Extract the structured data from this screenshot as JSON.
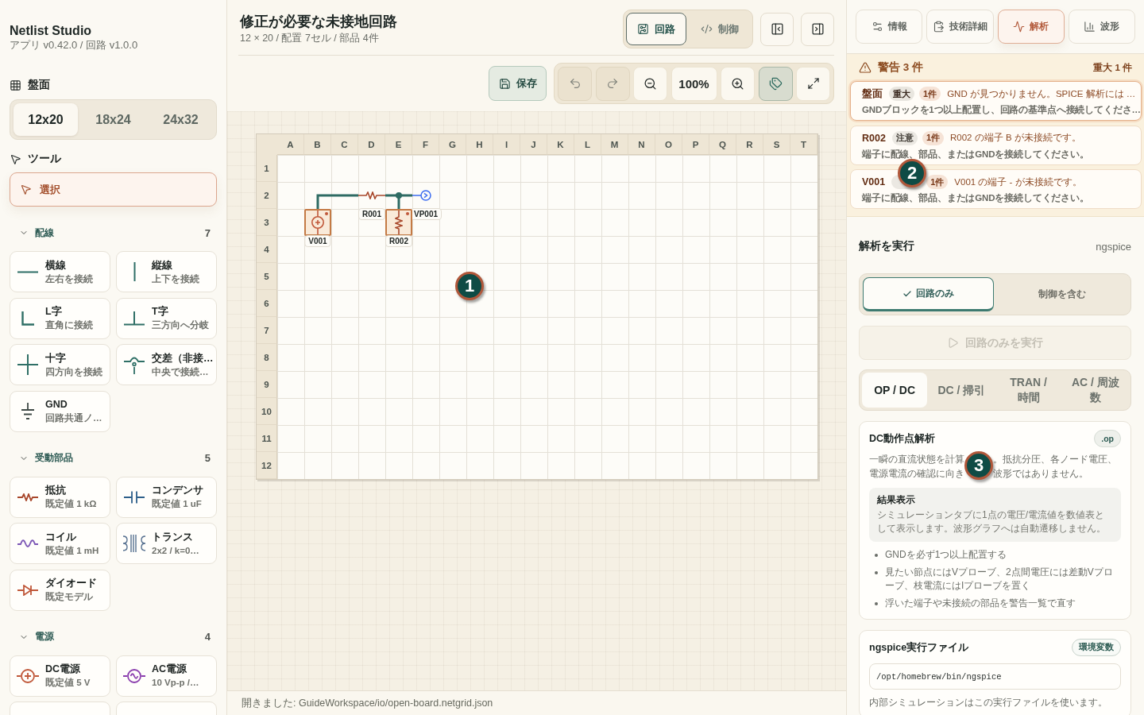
{
  "app": {
    "name": "Netlist Studio",
    "version": "アプリ v0.42.0 / 回路 v1.0.0"
  },
  "board_size": {
    "heading": "盤面",
    "options": [
      {
        "label": "12x20",
        "selected": true
      },
      {
        "label": "18x24",
        "selected": false
      },
      {
        "label": "24x32",
        "selected": false
      }
    ]
  },
  "tools": {
    "heading": "ツール",
    "items": [
      {
        "label": "選択",
        "selected": true
      }
    ]
  },
  "palette": [
    {
      "name": "配線",
      "count": "7",
      "expanded": true,
      "items": [
        {
          "kind": "wire-h",
          "title": "横線",
          "subtitle": "左右を接続"
        },
        {
          "kind": "wire-v",
          "title": "縦線",
          "subtitle": "上下を接続"
        },
        {
          "kind": "wire-l",
          "title": "L字",
          "subtitle": "直角に接続"
        },
        {
          "kind": "wire-t",
          "title": "T字",
          "subtitle": "三方向へ分岐"
        },
        {
          "kind": "wire-cross",
          "title": "十字",
          "subtitle": "四方向を接続"
        },
        {
          "kind": "wire-bridge",
          "title": "交差（非接…",
          "subtitle": "中央で接続…"
        },
        {
          "kind": "ground",
          "title": "GND",
          "subtitle": "回路共通ノ…"
        }
      ]
    },
    {
      "name": "受動部品",
      "count": "5",
      "expanded": true,
      "items": [
        {
          "kind": "resistor",
          "title": "抵抗",
          "subtitle": "既定値 1 kΩ"
        },
        {
          "kind": "capacitor",
          "title": "コンデンサ",
          "subtitle": "既定値 1 uF"
        },
        {
          "kind": "inductor",
          "title": "コイル",
          "subtitle": "既定値 1 mH"
        },
        {
          "kind": "transformer",
          "title": "トランス",
          "subtitle": "2x2 / k=0…"
        },
        {
          "kind": "diode",
          "title": "ダイオード",
          "subtitle": "既定モデル"
        }
      ]
    },
    {
      "name": "電源",
      "count": "4",
      "expanded": true,
      "items": [
        {
          "kind": "dc-source",
          "title": "DC電源",
          "subtitle": "既定値 5 V"
        },
        {
          "kind": "ac-source",
          "title": "AC電源",
          "subtitle": "10 Vp-p /…"
        },
        {
          "kind": "clipped"
        },
        {
          "kind": "clipped"
        }
      ]
    }
  ],
  "document": {
    "title": "修正が必要な未接地回路",
    "summary": "12 × 20 / 配置 7セル / 部品 4件"
  },
  "view_modes": [
    {
      "kind": "circuit",
      "label": "回路",
      "selected": true
    },
    {
      "kind": "code",
      "label": "制御",
      "selected": false
    }
  ],
  "panel_toggles": [
    {
      "kind": "left"
    },
    {
      "kind": "right"
    }
  ],
  "toolbar": {
    "save": {
      "label": "保存"
    },
    "buttons": [
      {
        "kind": "undo",
        "disabled": true,
        "on": false
      },
      {
        "kind": "redo",
        "disabled": true,
        "on": false
      },
      {
        "kind": "zoom-out",
        "disabled": false,
        "on": false
      },
      {
        "kind": "zoom-level",
        "label": "100%",
        "disabled": false,
        "on": false
      },
      {
        "kind": "zoom-in",
        "disabled": false,
        "on": false
      },
      {
        "kind": "labels",
        "disabled": false,
        "on": true
      },
      {
        "kind": "fullscreen",
        "disabled": false,
        "on": false
      }
    ]
  },
  "board": {
    "columns": [
      "A",
      "B",
      "C",
      "D",
      "E",
      "F",
      "G",
      "H",
      "I",
      "J",
      "K",
      "L",
      "M",
      "N",
      "O",
      "P",
      "Q",
      "R",
      "S",
      "T"
    ],
    "rows": [
      "1",
      "2",
      "3",
      "4",
      "5",
      "6",
      "7",
      "8",
      "9",
      "10",
      "11",
      "12"
    ],
    "cells": [
      [
        {
          "kind": "empty"
        }
      ],
      [
        {
          "kind": "empty"
        },
        {
          "kind": "wire-corner-se"
        },
        {
          "kind": "wire-h"
        },
        {
          "kind": "resistor-h",
          "ref": "R001",
          "unconnected": false
        },
        {
          "kind": "wire-tee-down"
        },
        {
          "kind": "probe",
          "ref": "VP001",
          "unconnected": false
        }
      ],
      [
        {
          "kind": "empty"
        },
        {
          "kind": "dc-source",
          "ref": "V001",
          "unconnected": true
        },
        {
          "kind": "empty"
        },
        {
          "kind": "empty"
        },
        {
          "kind": "resistor-v",
          "ref": "R002",
          "unconnected": true
        }
      ]
    ],
    "callout": "1"
  },
  "status_bar": {
    "message": "開きました: GuideWorkspace/io/open-board.netgrid.json"
  },
  "inspector_tabs": [
    {
      "kind": "info",
      "label": "情報",
      "selected": false
    },
    {
      "kind": "tech",
      "label": "技術詳細",
      "selected": false
    },
    {
      "kind": "analysis",
      "label": "解析",
      "selected": true
    },
    {
      "kind": "waveform",
      "label": "波形",
      "selected": false
    }
  ],
  "warnings": {
    "title": "警告 3 件",
    "summary": "重大 1 件",
    "callout": "2",
    "items": [
      {
        "kind": "critical",
        "source": "盤面",
        "severity": "重大",
        "count": "1件",
        "message": "GND が見つかりません。SPICE 解析には …",
        "hint": "GNDブロックを1つ以上配置し、回路の基準点へ接続してくださ…",
        "selected": true
      },
      {
        "kind": "warning",
        "source": "R002",
        "severity": "注意",
        "count": "1件",
        "message": "R002 の端子 B が未接続です。",
        "hint": "端子に配線、部品、またはGNDを接続してください。",
        "selected": false
      },
      {
        "kind": "warning",
        "source": "V001",
        "count": "1件",
        "message": "V001 の端子 - が未接続です。",
        "hint": "端子に配線、部品、またはGNDを接続してください。",
        "selected": false
      }
    ]
  },
  "run": {
    "title": "解析を実行",
    "engine": "ngspice",
    "scopes": [
      {
        "label": "回路のみ",
        "selected": true
      },
      {
        "label": "制御を含む",
        "selected": false
      }
    ],
    "run_button": {
      "label": "回路のみを実行",
      "disabled": true
    }
  },
  "analysis_types": [
    {
      "label": "OP / DC",
      "selected": true
    },
    {
      "label": "DC / 掃引",
      "selected": false
    },
    {
      "label": "TRAN / 時間",
      "selected": false
    },
    {
      "label": "AC / 周波数",
      "selected": false
    }
  ],
  "analysis_card": {
    "title": "DC動作点解析",
    "directive": ".op",
    "callout": "3",
    "description": [
      [
        "一瞬の直流状態を計算",
        "。抵抗分圧、各ノード電圧、"
      ],
      [
        "電源電流の確認に向き",
        "波形ではありません。"
      ]
    ],
    "result": {
      "title": "結果表示",
      "text": "シミュレーションタブに1点の電圧/電流値を数値表として表示します。波形グラフへは自動遷移しません。"
    },
    "tips": [
      "GNDを必ず1つ以上配置する",
      "見たい節点にはVプローブ、2点間電圧には差動Vプローブ、枝電流にはIプローブを置く",
      "浮いた端子や未接続の部品を警告一覧で直す"
    ]
  },
  "executable": {
    "title": "ngspice実行ファイル",
    "badge": "環境変数",
    "path": "/opt/homebrew/bin/ngspice",
    "note": "内部シミュレーションはこの実行ファイルを使います。"
  }
}
